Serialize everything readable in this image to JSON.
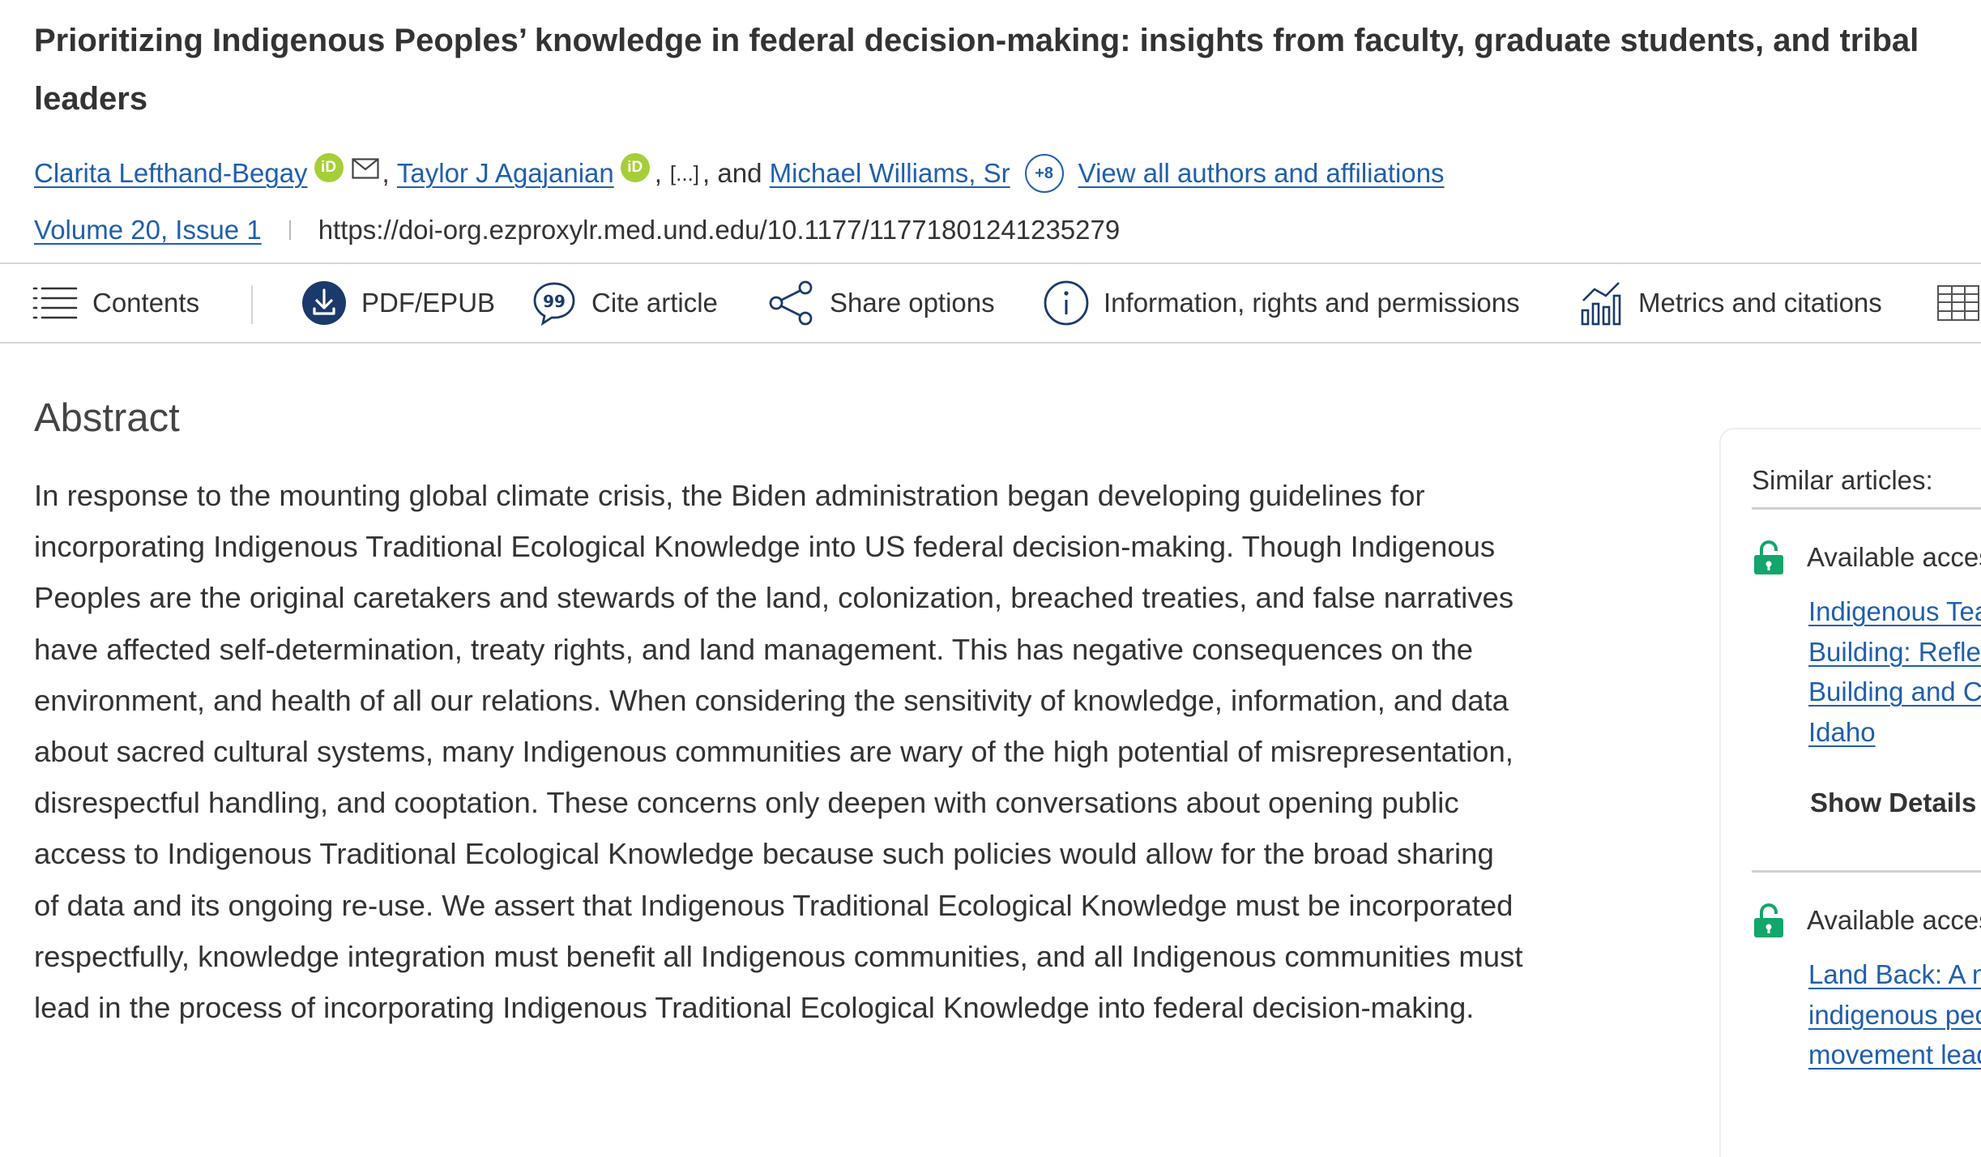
{
  "article": {
    "title": "Prioritizing Indigenous Peoples’ knowledge in federal decision-making: insights from faculty, graduate students, and tribal leaders",
    "authors": [
      {
        "name": "Clarita Lefthand-Begay",
        "orcid_label": "iD",
        "has_email": true
      },
      {
        "name": "Taylor J Agajanian",
        "orcid_label": "iD",
        "has_email": false
      }
    ],
    "authors_ellipsis": "[...]",
    "authors_and": "and",
    "last_author": "Michael Williams, Sr",
    "more_authors_badge": "+8",
    "view_all_link": "View all authors and affiliations",
    "volume_issue": "Volume 20, Issue 1",
    "doi": "https://doi-org.ezproxylr.med.und.edu/10.1177/11771801241235279"
  },
  "toolbar": {
    "contents": "Contents",
    "pdf": "PDF/EPUB",
    "cite": "Cite article",
    "share": "Share options",
    "info": "Information, rights and permissions",
    "metrics": "Metrics and citations"
  },
  "abstract": {
    "heading": "Abstract",
    "body": "In response to the mounting global climate crisis, the Biden administration began developing guidelines for incorporating Indigenous Traditional Ecological Knowledge into US federal decision-making. Though Indigenous Peoples are the original caretakers and stewards of the land, colonization, breached treaties, and false narratives have affected self-determination, treaty rights, and land management. This has negative consequences on the environment, and health of all our relations. When considering the sensitivity of knowledge, information, and data about sacred cultural systems, many Indigenous communities are wary of the high potential of misrepresentation, disrespectful handling, and cooptation. These concerns only deepen with conversations about opening public access to Indigenous Traditional Ecological Knowledge because such policies would allow for the broad sharing of data and its ongoing re-use. We assert that Indigenous Traditional Ecological Knowledge must be incorporated respectfully, knowledge integration must benefit all Indigenous communities, and all Indigenous communities must lead in the process of incorporating Indigenous Traditional Ecological Knowledge into federal decision-making."
  },
  "similar_articles": {
    "title": "Similar articles:",
    "items": [
      {
        "access_label": "Available access",
        "title_lines": [
          "Indigenous Teaching",
          "Building: Reflections",
          "Building and Co-",
          "Idaho"
        ],
        "details_label": "Show Details"
      },
      {
        "access_label": "Available access",
        "title_lines": [
          "Land Back: A meta-",
          "indigenous people",
          "movement leaders"
        ]
      }
    ]
  },
  "colors": {
    "link": "#1f5fad",
    "orcid": "#a6ce39",
    "open_access": "#12a66b",
    "pdf_icon": "#1a3a6b",
    "text": "#333333"
  },
  "icons": [
    "mail-icon",
    "orcid-icon",
    "menu-icon",
    "download-icon",
    "quote-icon",
    "share-icon",
    "info-icon",
    "bar-chart-icon",
    "table-icon",
    "unlock-icon"
  ]
}
